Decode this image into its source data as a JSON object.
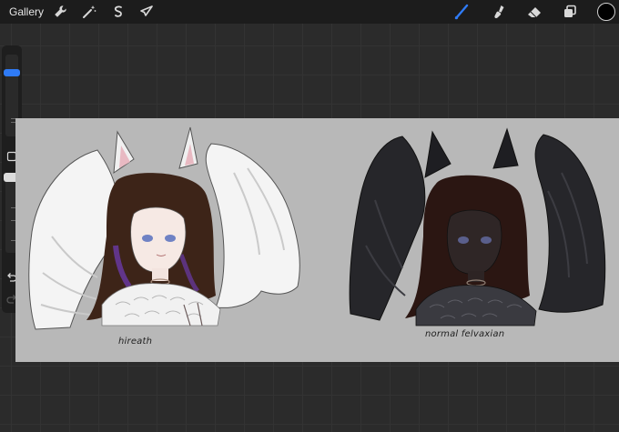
{
  "toolbar": {
    "gallery_label": "Gallery",
    "left_tools": [
      "wrench-icon",
      "magic-wand-icon",
      "selection-icon",
      "transform-arrow-icon"
    ],
    "right_tools": [
      "brush-icon",
      "smudge-icon",
      "eraser-icon",
      "layers-icon"
    ],
    "active_tool": "brush-icon",
    "accent_color": "#2f7bf6",
    "current_color": "#000000"
  },
  "sidebar": {
    "brush_size_level": 0.2,
    "opacity_level": 0.0,
    "buttons": [
      "modify-square-icon",
      "undo-icon",
      "redo-icon"
    ]
  },
  "canvas": {
    "labels": {
      "left": "hireath",
      "right": "normal felvaxian"
    }
  }
}
